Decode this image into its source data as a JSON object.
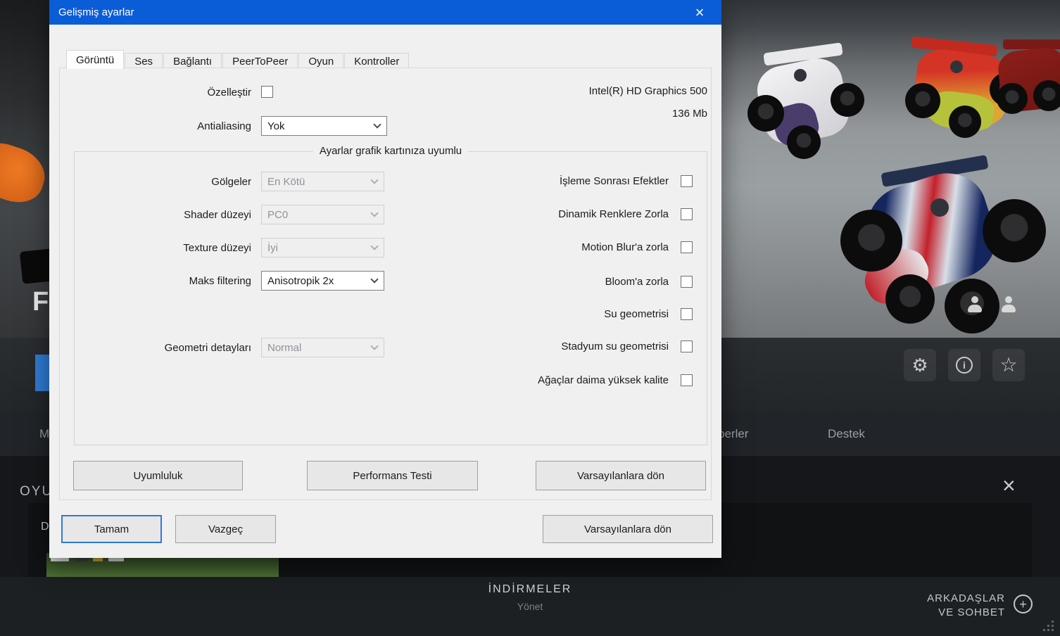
{
  "dialog": {
    "title": "Gelişmiş ayarlar",
    "close": "×",
    "tabs": [
      "Görüntü",
      "Ses",
      "Bağlantı",
      "PeerToPeer",
      "Oyun",
      "Kontroller"
    ],
    "customize_label": "Özelleştir",
    "gpu_name": "Intel(R) HD Graphics 500",
    "gpu_memory": "136 Mb",
    "antialiasing": {
      "label": "Antialiasing",
      "value": "Yok"
    },
    "group_title": "Ayarlar grafik kartınıza uyumlu",
    "selects": [
      {
        "label": "Gölgeler",
        "value": "En Kötü"
      },
      {
        "label": "Shader düzeyi",
        "value": "PC0"
      },
      {
        "label": "Texture düzeyi",
        "value": "İyi"
      },
      {
        "label": "Maks filtering",
        "value": "Anisotropik 2x"
      },
      {
        "label": "Geometri detayları",
        "value": "Normal"
      }
    ],
    "checkboxes": [
      "İşleme Sonrası Efektler",
      "Dinamik Renklere Zorla",
      "Motion Blur'a zorla",
      "Bloom'a zorla",
      "Su geometrisi",
      "Stadyum su geometrisi",
      "Ağaçlar daima yüksek kalite"
    ],
    "buttons": {
      "compat": "Uyumluluk",
      "perf": "Performans Testi",
      "defaults": "Varsayılanlara dön",
      "ok": "Tamam",
      "cancel": "Vazgeç",
      "defaults2": "Varsayılanlara dön"
    }
  },
  "launcher": {
    "menu_partial": "M",
    "menu_items": [
      "berler",
      "Destek"
    ],
    "section_title": "OYU",
    "section_close": "×",
    "panel_text": "D",
    "downloads_title": "İNDİRMELER",
    "downloads_subtitle": "Yönet",
    "friends_line1": "ARKADAŞLAR",
    "friends_line2": "VE SOHBET",
    "bg_letter": "F",
    "icons": {
      "gear": "⚙",
      "star": "☆",
      "info": "i",
      "plus": "+"
    }
  }
}
